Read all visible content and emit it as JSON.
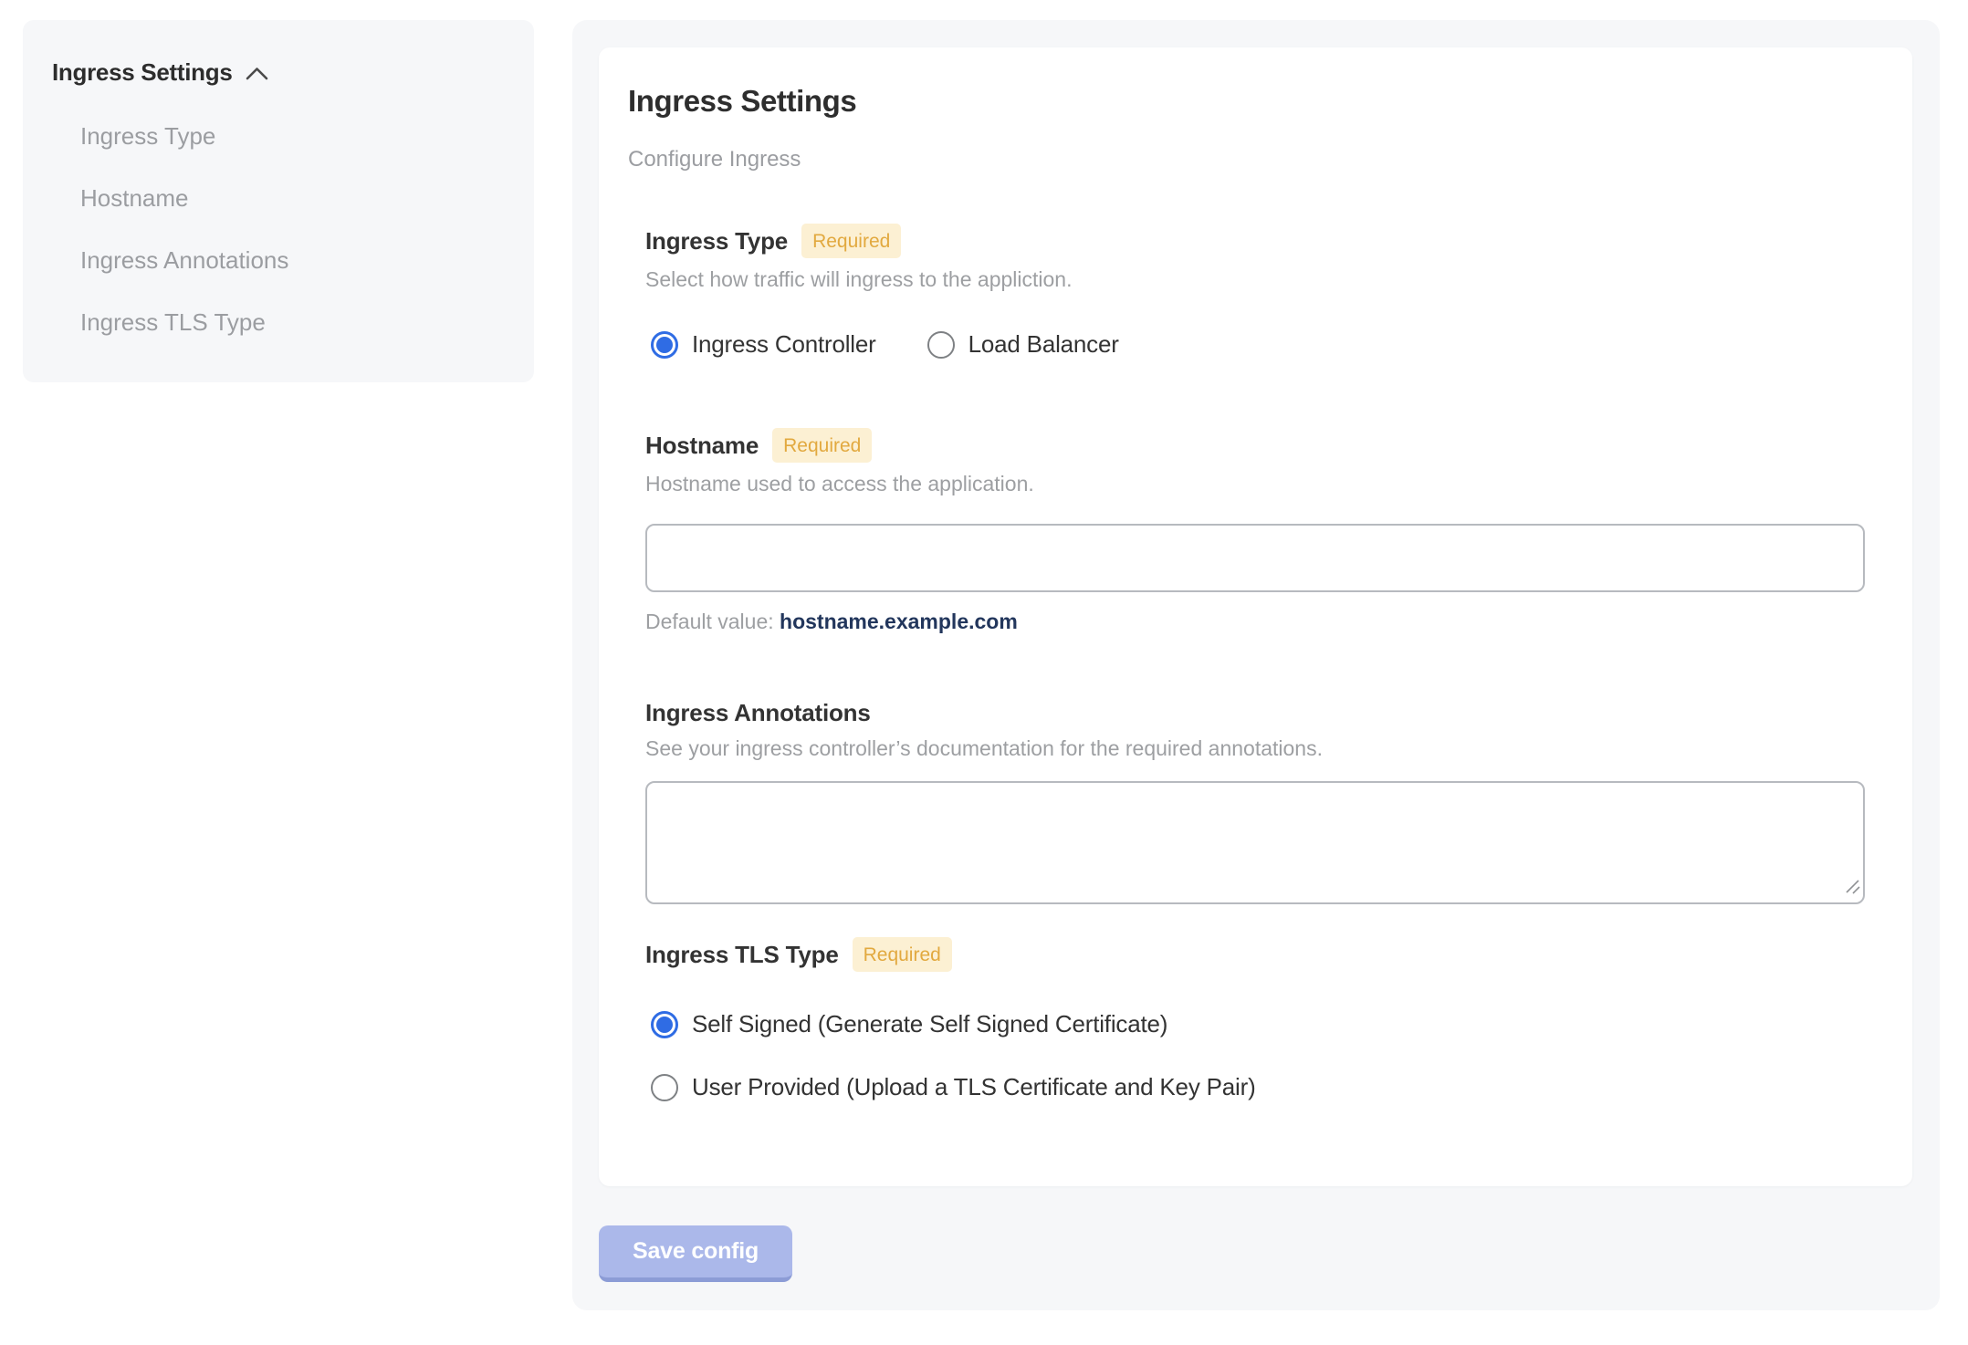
{
  "sidebar": {
    "group_title": "Ingress Settings",
    "collapse_icon": "chevron-up-icon",
    "items": [
      {
        "label": "Ingress Type"
      },
      {
        "label": "Hostname"
      },
      {
        "label": "Ingress Annotations"
      },
      {
        "label": "Ingress TLS Type"
      }
    ]
  },
  "main": {
    "title": "Ingress Settings",
    "subtitle": "Configure Ingress",
    "required_badge": "Required",
    "sections": {
      "ingress_type": {
        "label": "Ingress Type",
        "required": true,
        "help": "Select how traffic will ingress to the appliction.",
        "options": [
          {
            "label": "Ingress Controller",
            "selected": true
          },
          {
            "label": "Load Balancer",
            "selected": false
          }
        ]
      },
      "hostname": {
        "label": "Hostname",
        "required": true,
        "help": "Hostname used to access the application.",
        "input_value": "",
        "default_prefix": "Default value:",
        "default_value": "hostname.example.com"
      },
      "ingress_annotations": {
        "label": "Ingress Annotations",
        "required": false,
        "help": "See your ingress controller’s documentation for the required annotations.",
        "textarea_value": ""
      },
      "ingress_tls_type": {
        "label": "Ingress TLS Type",
        "required": true,
        "options": [
          {
            "label": "Self Signed (Generate Self Signed Certificate)",
            "selected": true
          },
          {
            "label": "User Provided (Upload a TLS Certificate and Key Pair)",
            "selected": false
          }
        ]
      }
    },
    "save_button_label": "Save config"
  },
  "colors": {
    "accent_blue": "#2f6ce4",
    "badge_bg": "#fcf0d3",
    "badge_text": "#e2a93f",
    "panel_gray": "#f6f7f9",
    "default_value_text": "#22365c",
    "save_button_bg": "#abb8ea"
  }
}
